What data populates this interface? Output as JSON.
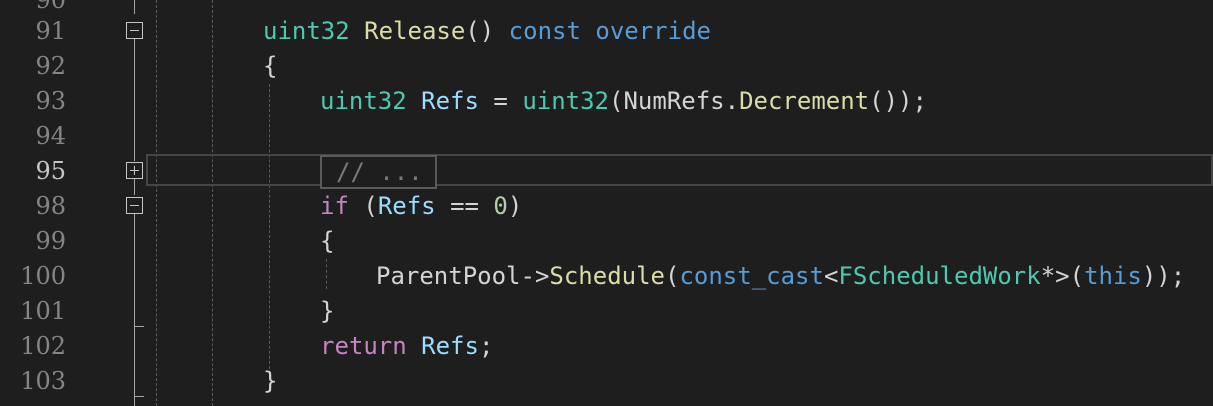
{
  "editor": {
    "line_numbers": [
      "90",
      "91",
      "92",
      "93",
      "94",
      "95",
      "98",
      "99",
      "100",
      "101",
      "102",
      "103"
    ],
    "current_line": "95",
    "collapsed_placeholder": "// ...",
    "lines": {
      "l91": {
        "type": "uint32",
        "fn": "Release",
        "parens": "()",
        "kw1": "const",
        "kw2": "override"
      },
      "l92": {
        "brace": "{"
      },
      "l93": {
        "type": "uint32",
        "var": "Refs",
        "eq": "=",
        "cast": "uint32",
        "open": "(",
        "obj": "NumRefs",
        "dot": ".",
        "method": "Decrement",
        "close": "());"
      },
      "l98": {
        "kw": "if",
        "open": "(",
        "var": "Refs",
        "op": "==",
        "num": "0",
        "close": ")"
      },
      "l99": {
        "brace": "{"
      },
      "l100": {
        "obj": "ParentPool",
        "arrow": "->",
        "method": "Schedule",
        "open": "(",
        "cast": "const_cast",
        "lt": "<",
        "type": "FScheduledWork",
        "star": "*",
        "gt": ">",
        "open2": "(",
        "this": "this",
        "close": "));"
      },
      "l101": {
        "brace": "}"
      },
      "l102": {
        "kw": "return",
        "var": "Refs",
        "semi": ";"
      },
      "l103": {
        "brace": "}"
      }
    }
  }
}
